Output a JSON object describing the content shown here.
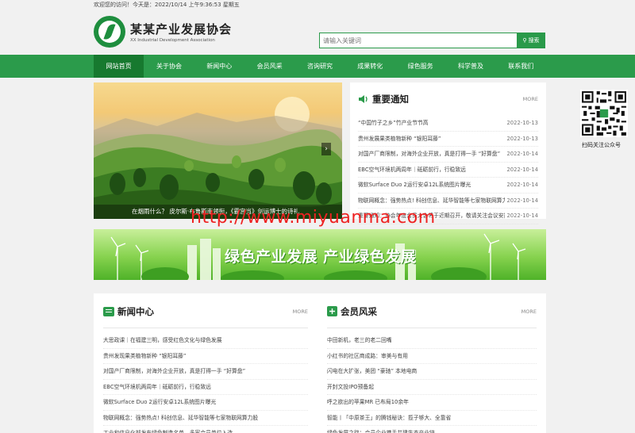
{
  "topbar": {
    "text": "欢迎您的访问！今天是：2022/10/14 上午9:36:53 星期五"
  },
  "logo": {
    "name": "某某产业发展协会",
    "english": "XX Industrial Development Association"
  },
  "search": {
    "placeholder": "请输入关键词",
    "button_label": "搜索"
  },
  "nav": {
    "items": [
      {
        "label": "网站首页"
      },
      {
        "label": "关于协会"
      },
      {
        "label": "新闻中心"
      },
      {
        "label": "会员风采"
      },
      {
        "label": "咨询研究"
      },
      {
        "label": "成果转化"
      },
      {
        "label": "绿色服务"
      },
      {
        "label": "科学普及"
      },
      {
        "label": "联系我们"
      }
    ]
  },
  "banner": {
    "caption": "在烟雨什么？ 皮尔斯·布鲁斯南领衔，《霸宫当》剑运博士的诗礼",
    "arrow": "›"
  },
  "notice": {
    "title": "重要通知",
    "more": "MORE",
    "items": [
      {
        "title": "“中国竹子之乡”竹产业节节高",
        "date": "2022-10-13"
      },
      {
        "title": "贵州发展果类植物新种 “银阳耳藤”",
        "date": "2022-10-13"
      },
      {
        "title": "对国产厂商限制，对海外企业开放，真是打得一手 “好算盘”",
        "date": "2022-10-14"
      },
      {
        "title": "EBC空气环境机两周年｜砥砺前行，行稳致远",
        "date": "2022-10-14"
      },
      {
        "title": "微软Surface Duo 2运行安卓12L系统图片曝光",
        "date": "2022-10-14"
      },
      {
        "title": "物联网概念：强势热点! 科创信息、延华智能等七家物联网算力",
        "date": "2022-10-14"
      },
      {
        "title": "重要通知：协会年度会员大会将于近期召开，敬请关注会议安排",
        "date": "2022-10-14"
      }
    ]
  },
  "qr": {
    "label": "扫码关注公众号"
  },
  "green_banner": {
    "text": "绿色产业发展 产业绿色发展"
  },
  "watermark": {
    "text": "http://www.miyuanma.com"
  },
  "news": {
    "title": "新闻中心",
    "more": "MORE",
    "items": [
      {
        "title": "大思政课｜在福建三明，感受红色文化与绿色发展"
      },
      {
        "title": "贵州发现果类植物新种 “银阳耳藤”"
      },
      {
        "title": "对国产厂商限制，对海外企业开放，真是打得一手 “好算盘”"
      },
      {
        "title": "EBC空气环境机两周年｜砥砺前行，行稳致远"
      },
      {
        "title": "微软Surface Duo 2运行安卓12L系统图片曝光"
      },
      {
        "title": "物联网概念：强势热点! 科创信息、延华智能等七家物联网算力股"
      },
      {
        "title": "工业和信息化部发布绿色制造名单，多家会员单位入选"
      }
    ]
  },
  "members": {
    "title": "会员风采",
    "more": "MORE",
    "items": [
      {
        "title": "中田新机，老三的老二回嘴"
      },
      {
        "title": "小红书的社区商成路：审美与有用"
      },
      {
        "title": "闪电在大扩张，美团 “豪驰” 本地电商"
      },
      {
        "title": "开封文投IPO预备起"
      },
      {
        "title": "呼之欲出的苹果MR 已布局10余年"
      },
      {
        "title": "智能丨「中原茶王」的腾钱秘诀：揽子够大、全靠省"
      },
      {
        "title": "绿色发展之路：会员企业携手共建生态产业链"
      }
    ]
  },
  "colors": {
    "brand_green": "#2b9b4b",
    "nav_active": "#17792f"
  }
}
